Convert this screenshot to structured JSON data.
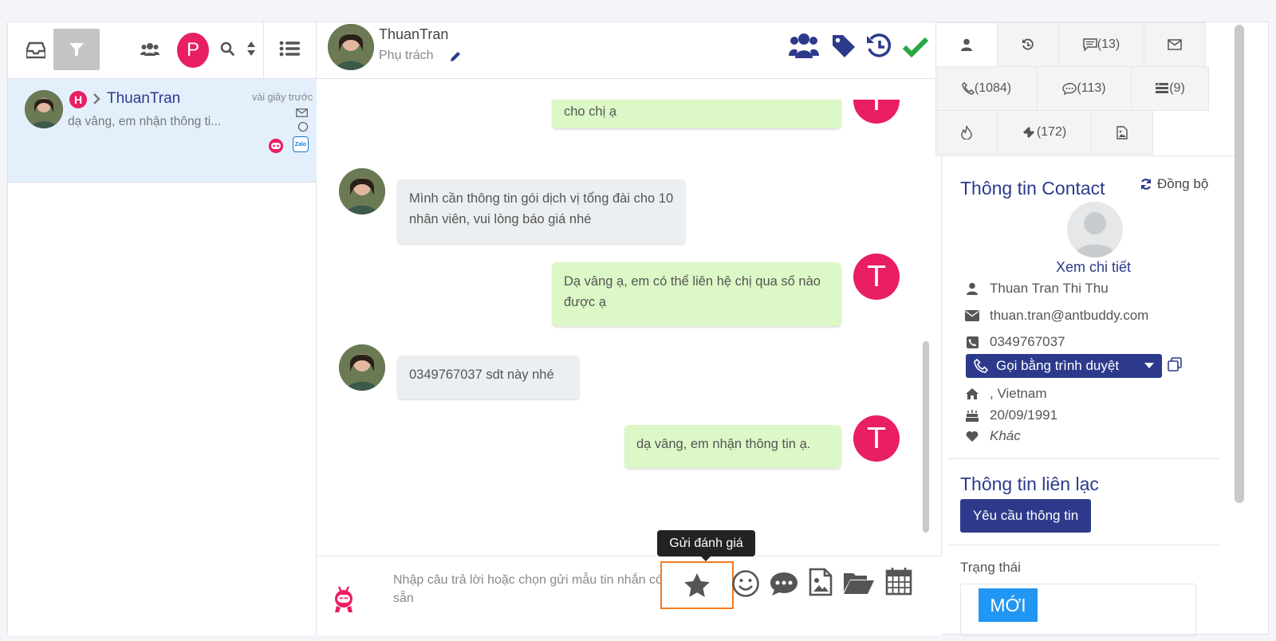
{
  "conversation_list": {
    "item": {
      "badge": "H",
      "name": "ThuanTran",
      "time": "vài giây trước",
      "preview": "dạ vâng, em nhận thông ti..."
    },
    "profile_letter": "P"
  },
  "chat_header": {
    "name": "ThuanTran",
    "assignee_label": "Phụ trách"
  },
  "messages": [
    {
      "dir": "out",
      "text": "cho chị ạ"
    },
    {
      "dir": "in",
      "text": "Mình cần thông tin gói dịch vị tổng đài cho 10 nhân viên, vui lòng báo giá nhé"
    },
    {
      "dir": "out",
      "text": "Dạ vâng ạ, em có thể liên hệ chị qua số nào được ạ"
    },
    {
      "dir": "in",
      "text": "0349767037 sdt này nhé"
    },
    {
      "dir": "out",
      "text": "dạ vâng, em nhận thông tin ạ."
    }
  ],
  "agent_avatar_letter": "T",
  "composer": {
    "placeholder": "Nhập câu trả lời hoặc chọn gửi mẫu tin nhắn có sẵn",
    "tooltip": "Gửi đánh giá"
  },
  "right_tabs": {
    "notes": "(13)",
    "calls": "(1084)",
    "chats": "(113)",
    "list": "(9)",
    "tickets": "(172)"
  },
  "contact": {
    "section_title": "Thông tin Contact",
    "sync_label": "Đồng bộ",
    "view_details": "Xem chi tiết",
    "name": "Thuan Tran Thi Thu",
    "email": "thuan.tran@antbuddy.com",
    "phone": "0349767037",
    "call_button": "Gọi bằng trình duyệt",
    "address": ", Vietnam",
    "birthday": "20/09/1991",
    "gender": "Khác"
  },
  "contact_info": {
    "section_title": "Thông tin liên lạc",
    "request_button": "Yêu cầu thông tin"
  },
  "status": {
    "label": "Trạng thái",
    "value": "MỚI"
  },
  "colors": {
    "accent_navy": "#2d3a8c",
    "pink": "#e91e63",
    "green_check": "#28a745",
    "highlight_orange": "#f47b20"
  }
}
